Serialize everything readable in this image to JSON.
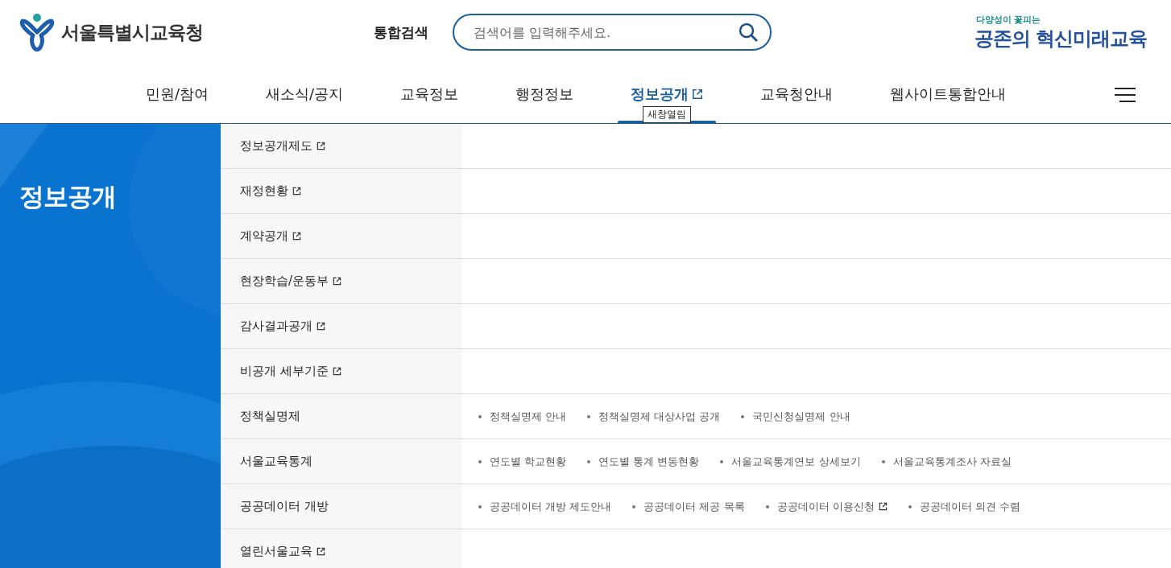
{
  "header": {
    "logo_text": "서울특별시교육청",
    "search_label": "통합검색",
    "search": {
      "placeholder": "검색어를 입력해주세요."
    },
    "slogan": {
      "small": "다양성이 꽃피는",
      "large": "공존의 혁신미래교육"
    }
  },
  "nav": [
    {
      "label": "민원/참여",
      "selected": false,
      "external": false
    },
    {
      "label": "새소식/공지",
      "selected": false,
      "external": false
    },
    {
      "label": "교육정보",
      "selected": false,
      "external": false
    },
    {
      "label": "행정정보",
      "selected": false,
      "external": false
    },
    {
      "label": "정보공개",
      "selected": true,
      "external": true,
      "tooltip": "새창열림"
    },
    {
      "label": "교육청안내",
      "selected": false,
      "external": false
    },
    {
      "label": "웹사이트통합안내",
      "selected": false,
      "external": false
    }
  ],
  "section_title": "정보공개",
  "menu": [
    {
      "label": "정보공개제도",
      "external": true
    },
    {
      "label": "재정현황",
      "external": true
    },
    {
      "label": "계약공개",
      "external": true
    },
    {
      "label": "현장학습/운동부",
      "external": true
    },
    {
      "label": "감사결과공개",
      "external": true
    },
    {
      "label": "비공개 세부기준",
      "external": true
    },
    {
      "label": "정책실명제",
      "external": false,
      "children": [
        {
          "label": "정책실명제 안내",
          "external": false
        },
        {
          "label": "정책실명제 대상사업 공개",
          "external": false
        },
        {
          "label": "국민신청실명제 안내",
          "external": false
        }
      ]
    },
    {
      "label": "서울교육통계",
      "external": false,
      "children": [
        {
          "label": "연도별 학교현황",
          "external": false
        },
        {
          "label": "연도별 통계 변동현황",
          "external": false
        },
        {
          "label": "서울교육통계연보 상세보기",
          "external": false
        },
        {
          "label": "서울교육통계조사 자료실",
          "external": false
        }
      ]
    },
    {
      "label": "공공데이터 개방",
      "external": false,
      "children": [
        {
          "label": "공공데이터 개방 제도안내",
          "external": false
        },
        {
          "label": "공공데이터 제공 목록",
          "external": false
        },
        {
          "label": "공공데이터 이용신청",
          "external": true
        },
        {
          "label": "공공데이터 의견 수렴",
          "external": false
        }
      ]
    },
    {
      "label": "열린서울교육",
      "external": true
    }
  ]
}
